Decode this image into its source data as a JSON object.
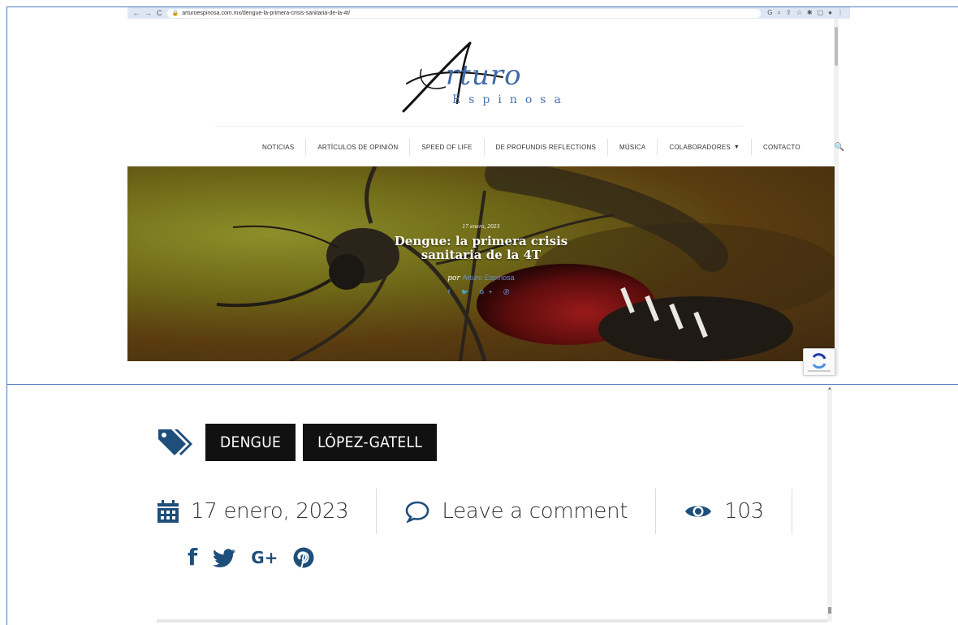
{
  "browser": {
    "url": "arturoespinosa.com.mx/dengue-la-primera-crisis-sanitaria-de-la-4t/",
    "back_glyph": "←",
    "forward_glyph": "→",
    "reload_glyph": "C"
  },
  "logo": {
    "name_script": "rturo",
    "name_sub": "Espinosa"
  },
  "menu": {
    "items": [
      {
        "label": "NOTICIAS"
      },
      {
        "label": "ARTÍCULOS DE OPINIÓN"
      },
      {
        "label": "SPEED OF LIFE"
      },
      {
        "label": "DE PROFUNDIS REFLECTIONS"
      },
      {
        "label": "MÚSICA"
      },
      {
        "label": "COLABORADORES"
      },
      {
        "label": "CONTACTO"
      }
    ],
    "dropdown_caret": "▼",
    "search_glyph": "🔍"
  },
  "hero": {
    "date": "17 enero, 2023",
    "title_line1": "Dengue: la primera crisis",
    "title_line2": "sanitaria de la 4T",
    "by_prefix": "por",
    "author": "Arturo Espinosa",
    "social_mini": "f 🐦 G+ ⓟ"
  },
  "tags": {
    "items": [
      "DENGUE",
      "LÓPEZ-GATELL"
    ]
  },
  "meta": {
    "date": "17 enero, 2023",
    "comment": "Leave a comment",
    "views": "103"
  },
  "social": {
    "facebook": "f",
    "googleplus": "G+"
  },
  "colors": {
    "accent": "#1e4e7a",
    "frame": "#4a7bc0",
    "tag_bg": "#111111"
  },
  "icons": [
    "tags-icon",
    "calendar-icon",
    "comment-icon",
    "eye-icon",
    "facebook-icon",
    "twitter-icon",
    "googleplus-icon",
    "pinterest-icon",
    "search-icon"
  ]
}
